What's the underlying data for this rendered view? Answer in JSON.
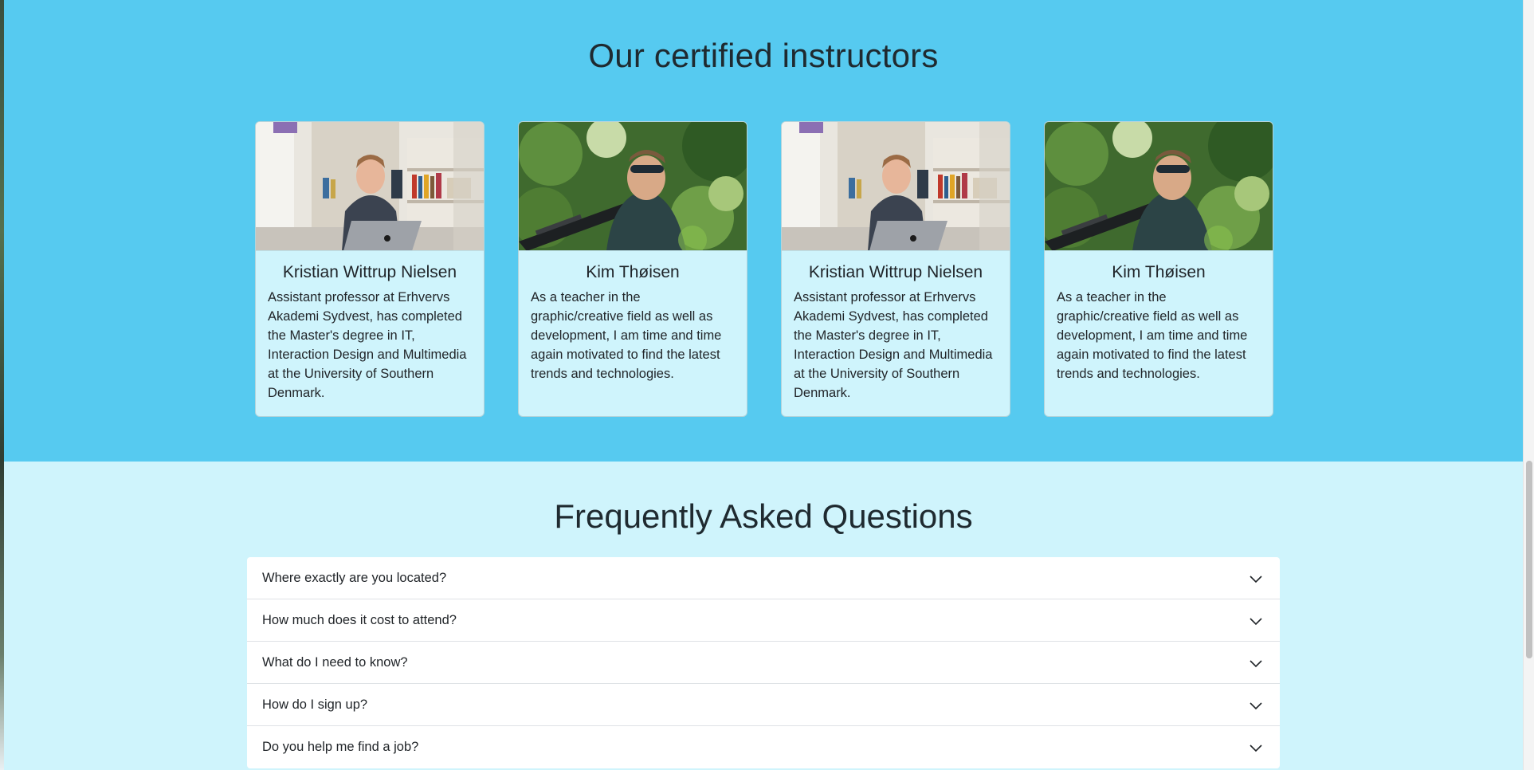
{
  "instructors": {
    "heading": "Our certified instructors",
    "cards": [
      {
        "name": "Kristian Wittrup Nielsen",
        "bio": "Assistant professor at Erhvervs Akademi Sydvest, has completed the Master's degree in IT, Interaction Design and Multimedia at the University of Southern Denmark.",
        "photo": "office-laptop-photo"
      },
      {
        "name": "Kim Thøisen",
        "bio": "As a teacher in the graphic/creative field as well as development, I am time and time again motivated to find the latest trends and technologies.",
        "photo": "outdoor-tripod-photo"
      },
      {
        "name": "Kristian Wittrup Nielsen",
        "bio": "Assistant professor at Erhvervs Akademi Sydvest, has completed the Master's degree in IT, Interaction Design and Multimedia at the University of Southern Denmark.",
        "photo": "office-laptop-photo"
      },
      {
        "name": "Kim Thøisen",
        "bio": "As a teacher in the graphic/creative field as well as development, I am time and time again motivated to find the latest trends and technologies.",
        "photo": "outdoor-tripod-photo"
      }
    ]
  },
  "faq": {
    "heading": "Frequently Asked Questions",
    "items": [
      {
        "question": "Where exactly are you located?"
      },
      {
        "question": "How much does it cost to attend?"
      },
      {
        "question": "What do I need to know?"
      },
      {
        "question": "How do I sign up?"
      },
      {
        "question": "Do you help me find a job?"
      }
    ],
    "toggle_icon": "chevron-down-icon"
  },
  "colors": {
    "instructors_bg": "#56caf0",
    "faq_bg": "#cff4fc",
    "card_bg": "#cff4fc"
  }
}
